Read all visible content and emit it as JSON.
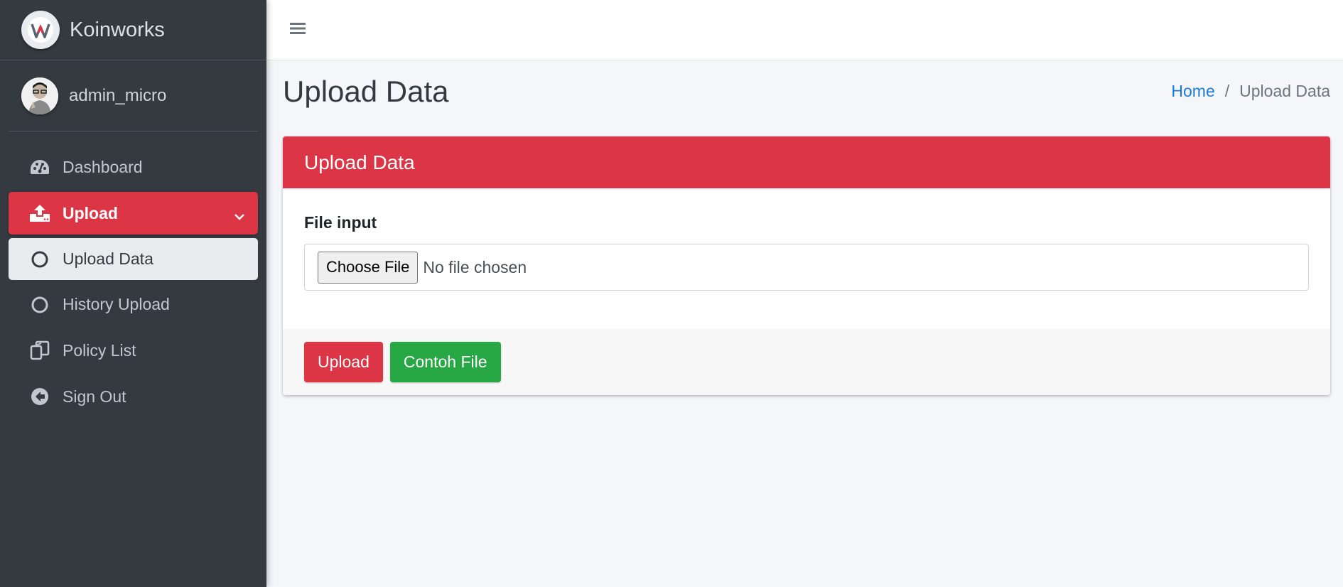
{
  "brand": {
    "name": "Koinworks"
  },
  "user": {
    "name": "admin_micro"
  },
  "sidebar": {
    "items": [
      {
        "label": "Dashboard",
        "icon": "tachometer-icon"
      },
      {
        "label": "Upload",
        "icon": "upload-icon"
      },
      {
        "label": "Upload Data",
        "icon": "circle-outline-icon"
      },
      {
        "label": "History Upload",
        "icon": "circle-outline-icon"
      },
      {
        "label": "Policy List",
        "icon": "copy-icon"
      },
      {
        "label": "Sign Out",
        "icon": "arrow-circle-left-icon"
      }
    ]
  },
  "header": {
    "menu_icon": "hamburger-icon"
  },
  "main": {
    "title": "Upload Data",
    "breadcrumb": {
      "home": "Home",
      "separator": "/",
      "current": "Upload Data"
    },
    "card": {
      "title": "Upload Data",
      "field_label": "File input",
      "choose_button": "Choose File",
      "file_status": "No file chosen",
      "upload_button": "Upload",
      "sample_button": "Contoh File"
    }
  },
  "colors": {
    "sidebar_bg": "#343a40",
    "accent_red": "#dc3545",
    "success_green": "#28a745",
    "link_blue": "#1e7bd3"
  }
}
